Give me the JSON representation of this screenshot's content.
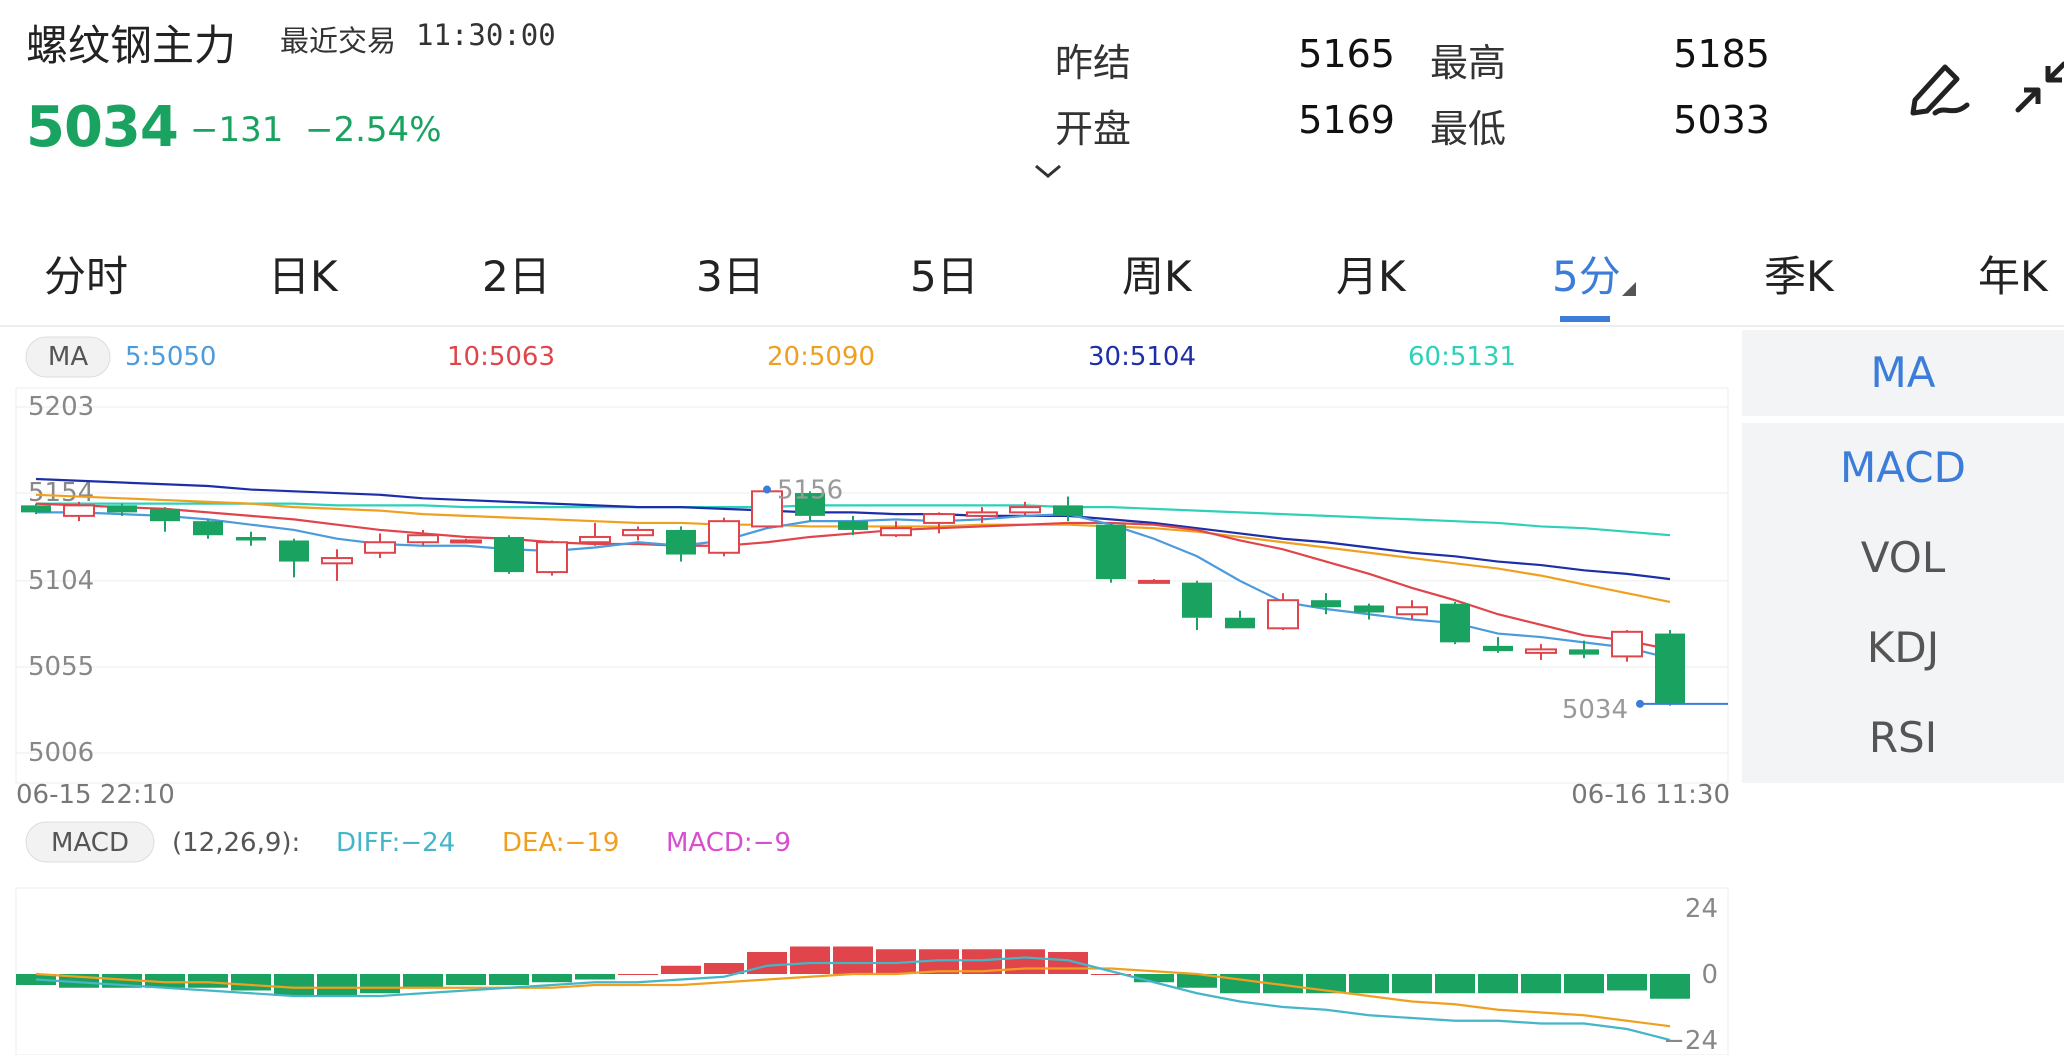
{
  "header": {
    "title": "螺纹钢主力",
    "time_label": "最近交易",
    "time": "11:30:00",
    "price": "5034",
    "change": "−131",
    "change_pct": "−2.54%",
    "stats": [
      {
        "label": "昨结",
        "value": "5165"
      },
      {
        "label": "最高",
        "value": "5185"
      },
      {
        "label": "开盘",
        "value": "5169"
      },
      {
        "label": "最低",
        "value": "5033"
      }
    ]
  },
  "tabs": [
    {
      "label": "分时"
    },
    {
      "label": "日K"
    },
    {
      "label": "2日"
    },
    {
      "label": "3日"
    },
    {
      "label": "5日"
    },
    {
      "label": "周K"
    },
    {
      "label": "月K"
    },
    {
      "label": "5分",
      "active": true
    },
    {
      "label": "季K"
    },
    {
      "label": "年K"
    }
  ],
  "side_panel": {
    "primary": "MA",
    "items": [
      "MACD",
      "VOL",
      "KDJ",
      "RSI"
    ]
  },
  "colors": {
    "up": "#e0454b",
    "down": "#1aa260",
    "ma5": "#4c9bdc",
    "ma10": "#e0454b",
    "ma20": "#f0a020",
    "ma30": "#1c2fa8",
    "ma60": "#2ed1b8",
    "diff": "#45b5c8",
    "dea": "#f0a020",
    "macd": "#d84ed0",
    "accent": "#3b7dd8"
  },
  "chart_data": [
    {
      "type": "candlestick",
      "indicator_label": "MA",
      "ma_legend": [
        {
          "label": "5:5050",
          "color": "ma5"
        },
        {
          "label": "10:5063",
          "color": "ma10"
        },
        {
          "label": "20:5090",
          "color": "ma20"
        },
        {
          "label": "30:5104",
          "color": "ma30"
        },
        {
          "label": "60:5131",
          "color": "ma60"
        }
      ],
      "y_ticks": [
        "5203",
        "5154",
        "5104",
        "5055",
        "5006"
      ],
      "ylim": [
        5006,
        5203
      ],
      "x_labels": [
        "06-15  22:10",
        "06-16  11:30"
      ],
      "max_label": "5156",
      "last_label": "5034",
      "candles": [
        {
          "o": 5147,
          "c": 5143,
          "h": 5148,
          "l": 5142
        },
        {
          "o": 5141,
          "c": 5147,
          "h": 5149,
          "l": 5138
        },
        {
          "o": 5147,
          "c": 5143,
          "h": 5148,
          "l": 5141
        },
        {
          "o": 5145,
          "c": 5138,
          "h": 5146,
          "l": 5132
        },
        {
          "o": 5138,
          "c": 5130,
          "h": 5139,
          "l": 5128
        },
        {
          "o": 5129,
          "c": 5127,
          "h": 5132,
          "l": 5124
        },
        {
          "o": 5127,
          "c": 5115,
          "h": 5128,
          "l": 5106
        },
        {
          "o": 5114,
          "c": 5117,
          "h": 5122,
          "l": 5104
        },
        {
          "o": 5120,
          "c": 5126,
          "h": 5131,
          "l": 5117
        },
        {
          "o": 5126,
          "c": 5130,
          "h": 5133,
          "l": 5124
        },
        {
          "o": 5127,
          "c": 5127,
          "h": 5128,
          "l": 5126
        },
        {
          "o": 5129,
          "c": 5109,
          "h": 5130,
          "l": 5108
        },
        {
          "o": 5109,
          "c": 5126,
          "h": 5127,
          "l": 5107
        },
        {
          "o": 5126,
          "c": 5129,
          "h": 5137,
          "l": 5124
        },
        {
          "o": 5130,
          "c": 5133,
          "h": 5135,
          "l": 5127
        },
        {
          "o": 5133,
          "c": 5119,
          "h": 5135,
          "l": 5115
        },
        {
          "o": 5120,
          "c": 5138,
          "h": 5140,
          "l": 5118
        },
        {
          "o": 5135,
          "c": 5155,
          "h": 5156,
          "l": 5134
        },
        {
          "o": 5154,
          "c": 5141,
          "h": 5155,
          "l": 5138
        },
        {
          "o": 5138,
          "c": 5133,
          "h": 5141,
          "l": 5130
        },
        {
          "o": 5130,
          "c": 5134,
          "h": 5138,
          "l": 5129
        },
        {
          "o": 5137,
          "c": 5142,
          "h": 5143,
          "l": 5131
        },
        {
          "o": 5141,
          "c": 5143,
          "h": 5146,
          "l": 5137
        },
        {
          "o": 5143,
          "c": 5146,
          "h": 5149,
          "l": 5141
        },
        {
          "o": 5147,
          "c": 5141,
          "h": 5152,
          "l": 5138
        },
        {
          "o": 5136,
          "c": 5105,
          "h": 5137,
          "l": 5103
        },
        {
          "o": 5104,
          "c": 5104,
          "h": 5105,
          "l": 5103
        },
        {
          "o": 5103,
          "c": 5083,
          "h": 5104,
          "l": 5076
        },
        {
          "o": 5083,
          "c": 5077,
          "h": 5087,
          "l": 5077
        },
        {
          "o": 5077,
          "c": 5093,
          "h": 5097,
          "l": 5076
        },
        {
          "o": 5093,
          "c": 5089,
          "h": 5097,
          "l": 5085
        },
        {
          "o": 5090,
          "c": 5086,
          "h": 5091,
          "l": 5082
        },
        {
          "o": 5085,
          "c": 5089,
          "h": 5093,
          "l": 5082
        },
        {
          "o": 5091,
          "c": 5069,
          "h": 5092,
          "l": 5068
        },
        {
          "o": 5067,
          "c": 5064,
          "h": 5072,
          "l": 5063
        },
        {
          "o": 5063,
          "c": 5065,
          "h": 5068,
          "l": 5059
        },
        {
          "o": 5065,
          "c": 5062,
          "h": 5070,
          "l": 5060
        },
        {
          "o": 5061,
          "c": 5075,
          "h": 5076,
          "l": 5058
        },
        {
          "o": 5074,
          "c": 5034,
          "h": 5076,
          "l": 5033
        }
      ],
      "ma5": [
        5143,
        5143,
        5142,
        5141,
        5139,
        5136,
        5133,
        5128,
        5125,
        5124,
        5124,
        5122,
        5121,
        5123,
        5126,
        5124,
        5127,
        5134,
        5138,
        5138,
        5139,
        5138,
        5139,
        5141,
        5142,
        5136,
        5128,
        5118,
        5104,
        5092,
        5088,
        5085,
        5082,
        5080,
        5074,
        5072,
        5069,
        5066,
        5060
      ],
      "ma10": [
        5148,
        5147,
        5146,
        5145,
        5143,
        5141,
        5139,
        5136,
        5133,
        5131,
        5129,
        5128,
        5126,
        5125,
        5125,
        5124,
        5124,
        5126,
        5129,
        5131,
        5133,
        5134,
        5135,
        5136,
        5137,
        5137,
        5136,
        5133,
        5127,
        5122,
        5115,
        5108,
        5100,
        5093,
        5085,
        5079,
        5073,
        5070,
        5065
      ],
      "ma20": [
        5153,
        5152,
        5151,
        5150,
        5149,
        5148,
        5146,
        5145,
        5144,
        5142,
        5141,
        5140,
        5139,
        5138,
        5137,
        5137,
        5136,
        5136,
        5135,
        5135,
        5135,
        5135,
        5136,
        5136,
        5136,
        5135,
        5134,
        5132,
        5129,
        5126,
        5123,
        5120,
        5117,
        5114,
        5111,
        5107,
        5102,
        5097,
        5092
      ],
      "ma30": [
        5162,
        5161,
        5160,
        5159,
        5158,
        5156,
        5155,
        5154,
        5153,
        5151,
        5150,
        5149,
        5148,
        5147,
        5146,
        5146,
        5145,
        5144,
        5143,
        5143,
        5142,
        5142,
        5141,
        5141,
        5141,
        5139,
        5137,
        5134,
        5131,
        5128,
        5126,
        5123,
        5120,
        5118,
        5115,
        5113,
        5110,
        5108,
        5105
      ],
      "ma60": [
        5148,
        5148,
        5148,
        5148,
        5148,
        5148,
        5148,
        5147,
        5147,
        5147,
        5146,
        5146,
        5146,
        5146,
        5146,
        5146,
        5146,
        5146,
        5147,
        5147,
        5147,
        5147,
        5147,
        5147,
        5146,
        5146,
        5145,
        5144,
        5143,
        5142,
        5141,
        5140,
        5139,
        5138,
        5137,
        5135,
        5134,
        5132,
        5130
      ]
    },
    {
      "type": "macd",
      "indicator_label": "MACD",
      "params": "(12,26,9):",
      "diff_label": "DIFF:−24",
      "dea_label": "DEA:−19",
      "macd_label": "MACD:−9",
      "y_ticks": [
        "24",
        "0",
        "−24"
      ],
      "ylim": [
        -24,
        24
      ],
      "hist": [
        -4,
        -5,
        -5,
        -5,
        -5,
        -6,
        -8,
        -8,
        -7,
        -5,
        -4,
        -4,
        -3,
        -2,
        0,
        3,
        4,
        8,
        10,
        10,
        9,
        9,
        9,
        9,
        8,
        0,
        -3,
        -5,
        -7,
        -7,
        -7,
        -7,
        -7,
        -7,
        -7,
        -7,
        -7,
        -6,
        -9
      ],
      "diff": [
        -2,
        -3,
        -4,
        -5,
        -6,
        -7,
        -8,
        -8,
        -8,
        -7,
        -6,
        -5,
        -4,
        -3,
        -3,
        -2,
        -1,
        3,
        4,
        4,
        4,
        5,
        5,
        6,
        5,
        1,
        -3,
        -7,
        -10,
        -12,
        -13,
        -15,
        -16,
        -17,
        -17,
        -18,
        -18,
        -20,
        -24
      ],
      "dea": [
        0,
        -1,
        -2,
        -3,
        -3,
        -4,
        -5,
        -5,
        -5,
        -5,
        -5,
        -5,
        -5,
        -4,
        -4,
        -4,
        -3,
        -2,
        -1,
        0,
        0,
        1,
        1,
        2,
        2,
        2,
        1,
        0,
        -2,
        -4,
        -6,
        -8,
        -10,
        -11,
        -13,
        -14,
        -15,
        -17,
        -19
      ]
    }
  ]
}
